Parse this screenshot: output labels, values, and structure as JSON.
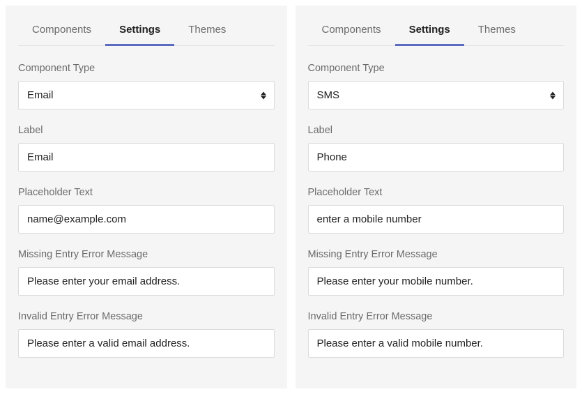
{
  "tabs": {
    "components": "Components",
    "settings": "Settings",
    "themes": "Themes"
  },
  "labels": {
    "componentType": "Component Type",
    "label": "Label",
    "placeholderText": "Placeholder Text",
    "missingEntry": "Missing Entry Error Message",
    "invalidEntry": "Invalid Entry Error Message"
  },
  "panelLeft": {
    "componentType": "Email",
    "label": "Email",
    "placeholder": "name@example.com",
    "missingMsg": "Please enter your email address.",
    "invalidMsg": "Please enter a valid email address."
  },
  "panelRight": {
    "componentType": "SMS",
    "label": "Phone",
    "placeholder": "enter a mobile number",
    "missingMsg": "Please enter your mobile number.",
    "invalidMsg": "Please enter a valid mobile number."
  }
}
